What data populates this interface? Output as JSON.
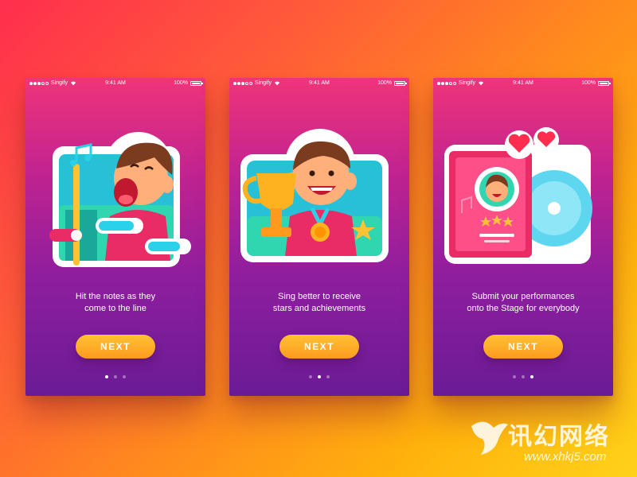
{
  "background_gradient": [
    "#ff2e4e",
    "#ff8a1e",
    "#ffd21a"
  ],
  "accent": "#ffa723",
  "screens": [
    {
      "status": {
        "carrier": "Singify",
        "time": "9:41 AM",
        "battery": "100%"
      },
      "illustration": "singing-boy-music-notes",
      "caption_line1": "Hit the notes as they",
      "caption_line2": "come to the line",
      "button_label": "NEXT",
      "active_page": 1
    },
    {
      "status": {
        "carrier": "Singify",
        "time": "9:41 AM",
        "battery": "100%"
      },
      "illustration": "boy-with-trophy-and-medal",
      "caption_line1": "Sing better to receive",
      "caption_line2": "stars and achievements",
      "button_label": "NEXT",
      "active_page": 2
    },
    {
      "status": {
        "carrier": "Singify",
        "time": "9:41 AM",
        "battery": "100%"
      },
      "illustration": "album-card-with-hearts",
      "caption_line1": "Submit your performances",
      "caption_line2": "onto the Stage for everybody",
      "button_label": "NEXT",
      "active_page": 3
    }
  ],
  "watermark": {
    "text": "讯幻网络",
    "url": "www.xhkj5.com"
  }
}
